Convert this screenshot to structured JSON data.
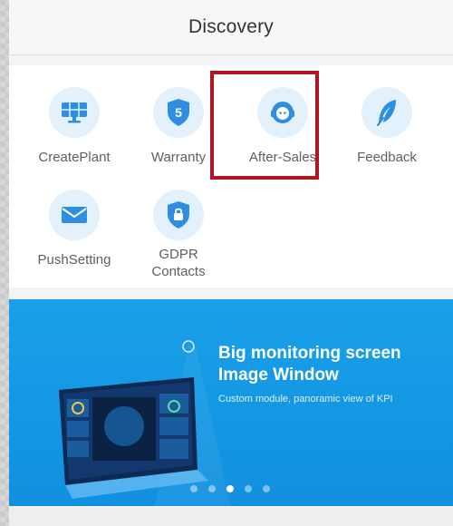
{
  "header": {
    "title": "Discovery"
  },
  "menu": {
    "items": [
      {
        "label": "CreatePlant",
        "icon": "solar-panel-icon"
      },
      {
        "label": "Warranty",
        "icon": "shield-5-icon"
      },
      {
        "label": "After-Sales",
        "icon": "support-agent-icon"
      },
      {
        "label": "Feedback",
        "icon": "feather-icon"
      },
      {
        "label": "PushSetting",
        "icon": "envelope-icon"
      },
      {
        "label": "GDPR Contacts",
        "icon": "lock-shield-icon"
      }
    ],
    "selected": "After-Sales"
  },
  "banner": {
    "title": "Big monitoring screen Image Window",
    "subtitle": "Custom module, panoramic view of KPI",
    "carousel_pages": 5,
    "carousel_active": 3
  },
  "colors": {
    "accent": "#1e9be8",
    "icon_bg": "#e2f1fb",
    "highlight": "#b01520",
    "banner": "#1190e0"
  }
}
